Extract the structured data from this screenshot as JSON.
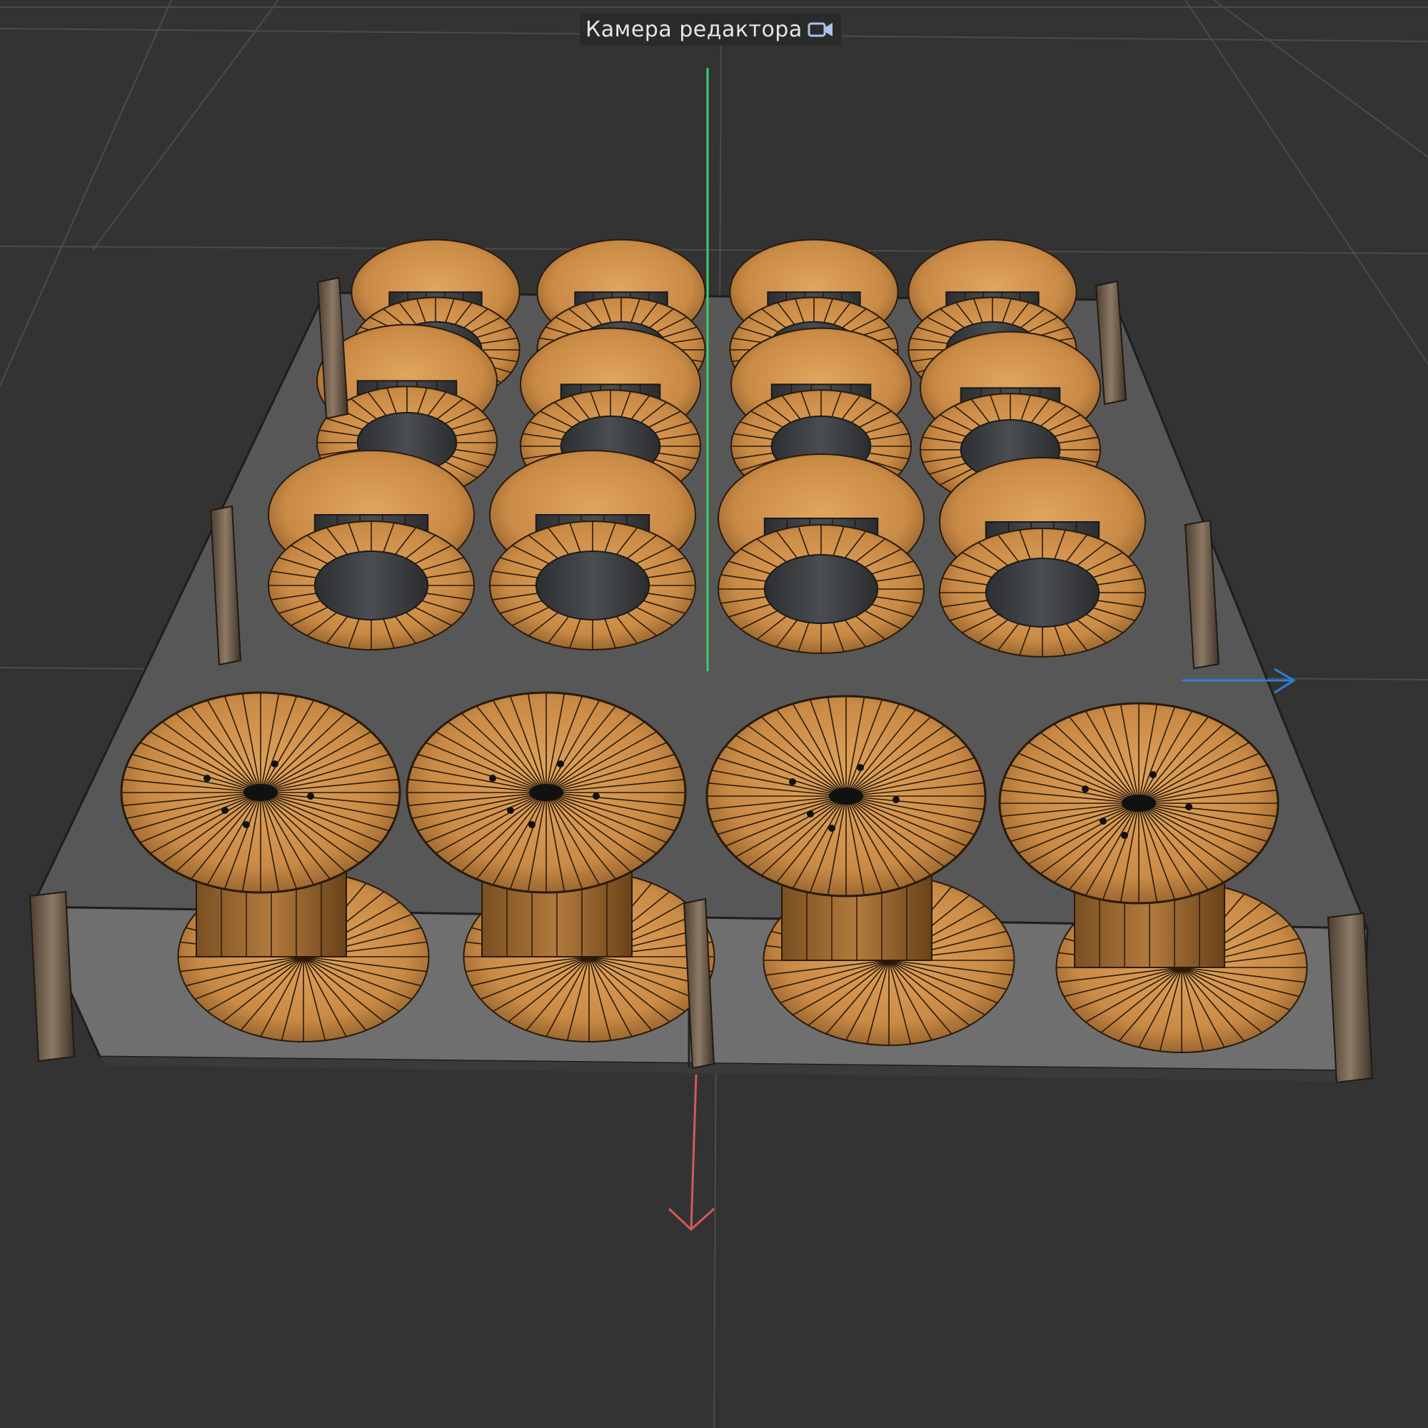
{
  "viewport": {
    "camera_label": "Камера редактора",
    "camera_icon": "camera-icon",
    "background_color": "#333333",
    "axes": {
      "y_color": "#3fd06a",
      "x_color": "#d25a5a",
      "z_color": "#2e7fd8"
    },
    "scene": {
      "object": "cable-spool-pallet",
      "spool_rows": 4,
      "spool_columns": 4,
      "spool_color": "#c98a45",
      "core_color": "#3b3d40"
    }
  }
}
